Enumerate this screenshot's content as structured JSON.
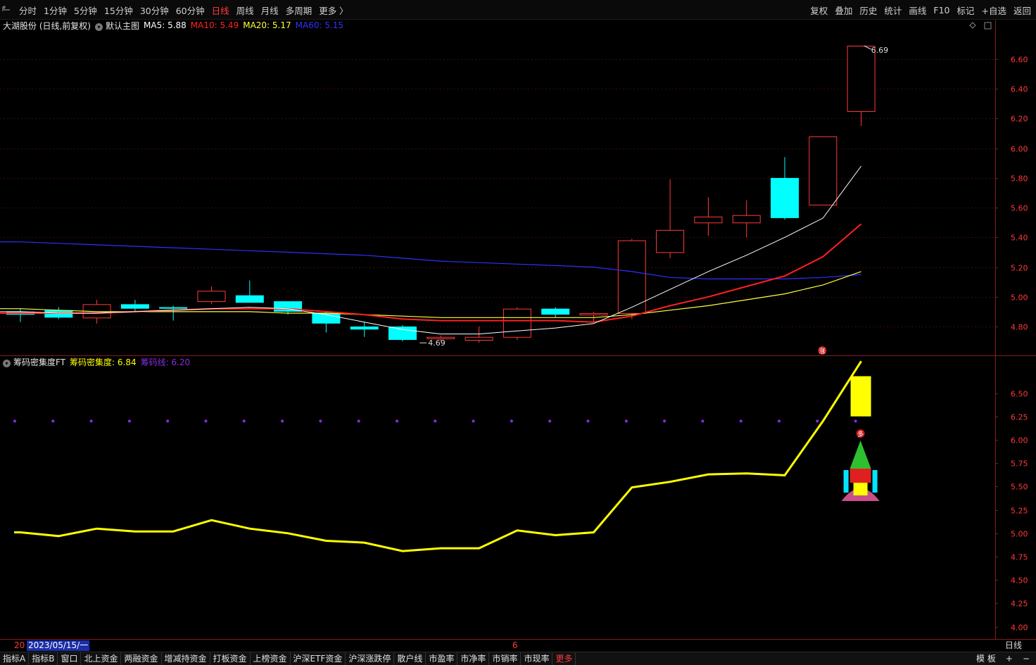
{
  "toolbar": {
    "window_icon": "window-icon",
    "periods": [
      "分时",
      "1分钟",
      "5分钟",
      "15分钟",
      "30分钟",
      "60分钟",
      "日线",
      "周线",
      "月线",
      "多周期",
      "更多 〉"
    ],
    "active_period": "日线",
    "tools": [
      "复权",
      "叠加",
      "历史",
      "统计",
      "画线",
      "F10",
      "标记",
      "+自选",
      "返回"
    ]
  },
  "main_chart": {
    "stock_title": "大湖股份 (日线,前复权)",
    "template_name": "默认主图",
    "ma5": "MA5: 5.88",
    "ma10": "MA10: 5.49",
    "ma20": "MA20: 5.17",
    "ma60": "MA60: 5.15",
    "high_label": "6.69",
    "low_label": "4.69",
    "limit_badge": "涨",
    "price_ticks": [
      "6.60",
      "6.40",
      "6.20",
      "6.00",
      "5.80",
      "5.60",
      "5.40",
      "5.20",
      "5.00",
      "4.80"
    ]
  },
  "sub_chart": {
    "indicator_name": "筹码密集度FT",
    "density": "筹码密集度: 6.84",
    "chip_line": "筹码线: 6.20",
    "ticks": [
      "6.50",
      "6.25",
      "6.00",
      "5.75",
      "5.50",
      "5.25",
      "5.00",
      "4.75",
      "4.50",
      "4.25",
      "4.00"
    ],
    "badge": "多"
  },
  "time_axis": {
    "prefix": "20",
    "selected_date": "2023/05/15/一",
    "month_mark": "6",
    "period": "日线"
  },
  "bottom_tabs": [
    "指标A",
    "指标B",
    "窗口",
    "北上资金",
    "两融资金",
    "增减持资金",
    "打板资金",
    "上榜资金",
    "沪深ETF资金",
    "沪深涨跌停",
    "散户线",
    "市盈率",
    "市净率",
    "市销率",
    "市现率",
    "更多"
  ],
  "bottom_right": [
    "模 板",
    "+",
    "−"
  ],
  "colors": {
    "up": "#ff3a3a",
    "down": "#00ffff",
    "ma5": "#ffffff",
    "ma10": "#ff2020",
    "ma20": "#ffff40",
    "ma60": "#3030ff",
    "density": "#ffff00",
    "chip": "#8a2be2"
  },
  "chart_data": [
    {
      "type": "candlestick",
      "title": "大湖股份 (日线,前复权)",
      "y_range": [
        4.62,
        6.78
      ],
      "candles": [
        {
          "o": 4.9,
          "h": 4.92,
          "l": 4.83,
          "c": 4.88
        },
        {
          "o": 4.91,
          "h": 4.93,
          "l": 4.85,
          "c": 4.86
        },
        {
          "o": 4.86,
          "h": 4.98,
          "l": 4.82,
          "c": 4.95
        },
        {
          "o": 4.95,
          "h": 4.98,
          "l": 4.9,
          "c": 4.92
        },
        {
          "o": 4.93,
          "h": 4.94,
          "l": 4.84,
          "c": 4.92
        },
        {
          "o": 4.97,
          "h": 5.07,
          "l": 4.95,
          "c": 5.04
        },
        {
          "o": 5.01,
          "h": 5.11,
          "l": 4.98,
          "c": 4.96
        },
        {
          "o": 4.97,
          "h": 4.97,
          "l": 4.88,
          "c": 4.9
        },
        {
          "o": 4.89,
          "h": 4.9,
          "l": 4.76,
          "c": 4.82
        },
        {
          "o": 4.8,
          "h": 4.83,
          "l": 4.73,
          "c": 4.78
        },
        {
          "o": 4.8,
          "h": 4.81,
          "l": 4.7,
          "c": 4.71
        },
        {
          "o": 4.72,
          "h": 4.74,
          "l": 4.7,
          "c": 4.73
        },
        {
          "o": 4.71,
          "h": 4.8,
          "l": 4.69,
          "c": 4.73
        },
        {
          "o": 4.73,
          "h": 4.93,
          "l": 4.71,
          "c": 4.92
        },
        {
          "o": 4.92,
          "h": 4.93,
          "l": 4.86,
          "c": 4.88
        },
        {
          "o": 4.88,
          "h": 4.9,
          "l": 4.83,
          "c": 4.89
        },
        {
          "o": 4.89,
          "h": 5.39,
          "l": 4.85,
          "c": 5.38
        },
        {
          "o": 5.3,
          "h": 5.79,
          "l": 5.26,
          "c": 5.45
        },
        {
          "o": 5.5,
          "h": 5.67,
          "l": 5.41,
          "c": 5.54
        },
        {
          "o": 5.5,
          "h": 5.65,
          "l": 5.4,
          "c": 5.55
        },
        {
          "o": 5.8,
          "h": 5.94,
          "l": 5.52,
          "c": 5.53
        },
        {
          "o": 5.62,
          "h": 6.08,
          "l": 5.62,
          "c": 6.08
        },
        {
          "o": 6.25,
          "h": 6.69,
          "l": 6.15,
          "c": 6.69
        }
      ],
      "ma5": [
        4.9,
        4.89,
        4.89,
        4.9,
        4.91,
        4.92,
        4.93,
        4.92,
        4.88,
        4.83,
        4.78,
        4.75,
        4.75,
        4.77,
        4.79,
        4.82,
        4.93,
        5.05,
        5.17,
        5.28,
        5.4,
        5.53,
        5.88
      ],
      "ma10": [
        4.89,
        4.89,
        4.89,
        4.9,
        4.91,
        4.92,
        4.92,
        4.92,
        4.9,
        4.88,
        4.85,
        4.84,
        4.84,
        4.84,
        4.84,
        4.83,
        4.87,
        4.94,
        5.0,
        5.07,
        5.14,
        5.27,
        5.49
      ],
      "ma20": [
        4.92,
        4.91,
        4.9,
        4.9,
        4.9,
        4.9,
        4.9,
        4.89,
        4.89,
        4.88,
        4.87,
        4.86,
        4.86,
        4.86,
        4.86,
        4.86,
        4.88,
        4.91,
        4.94,
        4.98,
        5.02,
        5.08,
        5.17
      ],
      "ma60": [
        5.37,
        5.36,
        5.35,
        5.34,
        5.33,
        5.32,
        5.31,
        5.3,
        5.29,
        5.28,
        5.26,
        5.24,
        5.23,
        5.22,
        5.21,
        5.2,
        5.17,
        5.13,
        5.12,
        5.12,
        5.12,
        5.13,
        5.15
      ],
      "high_annotation": 6.69,
      "low_annotation": 4.69
    },
    {
      "type": "line",
      "title": "筹码密集度FT",
      "y_range": [
        3.9,
        6.85
      ],
      "density": [
        5.01,
        4.97,
        5.05,
        5.02,
        5.02,
        5.14,
        5.05,
        5.0,
        4.92,
        4.9,
        4.81,
        4.84,
        4.84,
        5.03,
        4.98,
        5.01,
        5.49,
        5.55,
        5.63,
        5.64,
        5.62,
        6.2,
        6.84
      ],
      "chip_line": [
        6.2,
        6.2,
        6.2,
        6.2,
        6.2,
        6.2,
        6.2,
        6.2,
        6.2,
        6.2,
        6.2,
        6.2,
        6.2,
        6.2,
        6.2,
        6.2,
        6.2,
        6.2,
        6.2,
        6.2,
        6.2,
        6.2,
        6.2
      ],
      "signal_bar": {
        "from": 6.25,
        "to": 6.68
      }
    }
  ]
}
